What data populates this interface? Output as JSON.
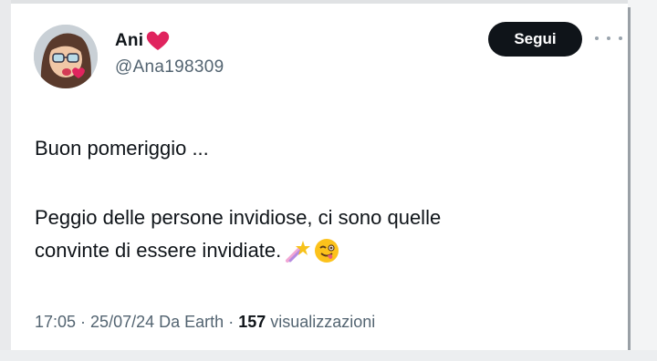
{
  "tweet": {
    "author": {
      "display_name": "Ani",
      "handle": "@Ana198309",
      "avatar": "memoji-avatar",
      "name_emoji": "red-heart"
    },
    "follow_label": "Segui",
    "more_icon": "more-horizontal-icon",
    "lines": [
      "Buon pomeriggio ...",
      "Peggio delle persone invidiose, ci sono quelle",
      "convinte di essere invidiate."
    ],
    "emojis": [
      "shooting-star-emoji",
      "winking-face-tongue-emoji"
    ],
    "meta": {
      "time": "17:05",
      "date": "25/07/24",
      "source": "Da Earth",
      "separator": " · ",
      "views_count": "157",
      "views_label": "visualizzazioni"
    }
  },
  "colors": {
    "text": "#0f1419",
    "secondary": "#536471",
    "button_bg": "#0f1419",
    "heart": "#e0245e"
  }
}
